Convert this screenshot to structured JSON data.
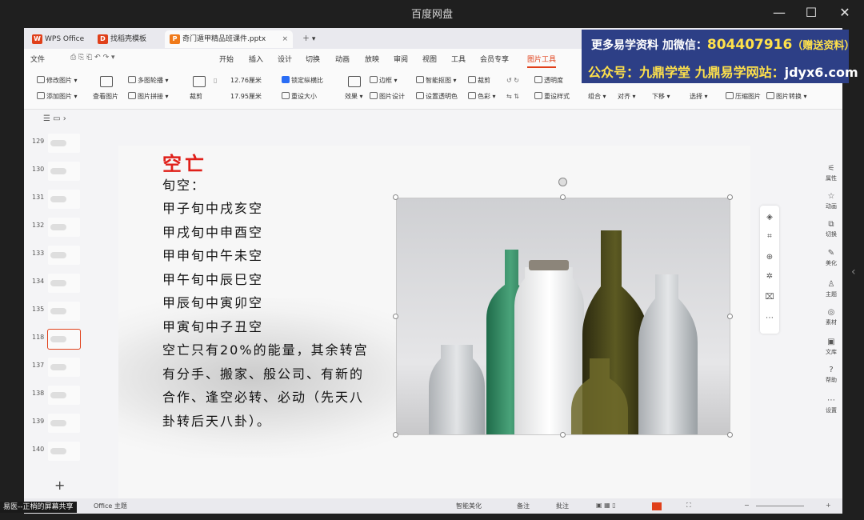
{
  "player": {
    "title": "百度网盘"
  },
  "tabs": [
    {
      "label": "WPS Office",
      "icon": "W"
    },
    {
      "label": "找稻壳模板",
      "icon": "D"
    },
    {
      "label": "奇门遁甲精品班课件.pptx",
      "icon": "P"
    }
  ],
  "menu": {
    "file": "文件",
    "items": [
      "开始",
      "插入",
      "设计",
      "切换",
      "动画",
      "放映",
      "审阅",
      "视图",
      "工具",
      "会员专享",
      "图片工具"
    ],
    "active": "图片工具"
  },
  "ribbon": {
    "row1": [
      "修改图片",
      "多图轮播",
      "12.76厘米",
      "锁定纵横比",
      "边框",
      "智能抠图",
      "裁剪",
      "透明度"
    ],
    "row2": [
      "添加图片",
      "查看图片",
      "图片拼接",
      "裁剪",
      "17.95厘米",
      "重设大小",
      "效果",
      "图片设计",
      "设置透明色",
      "色彩",
      "重设样式",
      "组合",
      "对齐",
      "下移",
      "选择",
      "压缩图片",
      "图片转换"
    ]
  },
  "thumbnails": [
    {
      "num": "129"
    },
    {
      "num": "130"
    },
    {
      "num": "131"
    },
    {
      "num": "132"
    },
    {
      "num": "133"
    },
    {
      "num": "134"
    },
    {
      "num": "135"
    },
    {
      "num": "118",
      "active": true
    },
    {
      "num": "137"
    },
    {
      "num": "138"
    },
    {
      "num": "139"
    },
    {
      "num": "140"
    }
  ],
  "slide": {
    "title": "空亡",
    "lines": [
      "旬空：",
      "甲子旬中戌亥空",
      "甲戌旬中申酉空",
      "甲申旬中午未空",
      "甲午旬中辰巳空",
      "甲辰旬中寅卯空",
      "甲寅旬中子丑空",
      "空亡只有20%的能量，其余转宫",
      "有分手、搬家、般公司、有新的",
      "合作、逢空必转、必动（先天八",
      "卦转后天八卦）。"
    ]
  },
  "right_panel": [
    "属性",
    "动画",
    "切换",
    "美化",
    "主题",
    "素材",
    "文库",
    "帮助",
    "设置"
  ],
  "statusbar": {
    "theme": "Office 主题",
    "smart": "智能美化",
    "notes": "备注",
    "comment": "批注"
  },
  "overlay": {
    "line1_prefix": "更多易学资料 加微信：",
    "wechat": "804407916",
    "line1_suffix": "（赠送资料）",
    "line2_prefix": "公众号：九鼎学堂 九鼎易学网站：",
    "site": "jdyx6.com"
  },
  "share_label": "易医--正梢的屏幕共享",
  "colors": {
    "accent": "#e0401a",
    "title_red": "#e0201a",
    "ad_bg": "#2d3f86",
    "ad_yellow": "#ffe14a"
  }
}
